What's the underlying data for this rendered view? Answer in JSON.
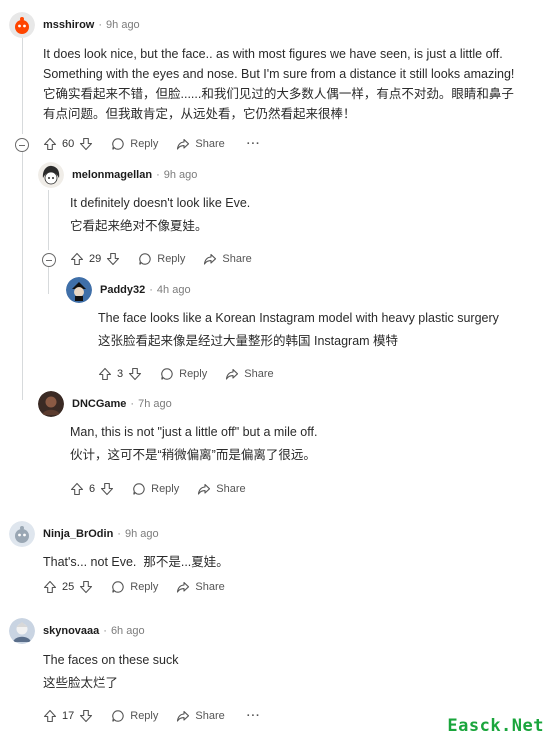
{
  "comments": [
    {
      "author": "msshirow",
      "sep": "·",
      "time": "9h ago",
      "text_en": "It does look nice, but the face.. as with most figures we have seen, is just a little off. Something with the eyes and nose. But I'm sure from a distance it still looks amazing!",
      "text_zh": "它确实看起来不错，但脸......和我们见过的大多数人偶一样，有点不对劲。眼睛和鼻子有点问题。但我敢肯定，从远处看，它仍然看起来很棒！",
      "votes": "60",
      "reply": "Reply",
      "share": "Share",
      "more": "···"
    },
    {
      "author": "melonmagellan",
      "sep": "·",
      "time": "9h ago",
      "text_en": "It definitely doesn't look like Eve.",
      "text_zh": "它看起来绝对不像夏娃。",
      "votes": "29",
      "reply": "Reply",
      "share": "Share"
    },
    {
      "author": "Paddy32",
      "sep": "·",
      "time": "4h ago",
      "text_en": "The face looks like a Korean Instagram model with heavy plastic surgery",
      "text_zh": "这张脸看起来像是经过大量整形的韩国 Instagram 模特",
      "votes": "3",
      "reply": "Reply",
      "share": "Share"
    },
    {
      "author": "DNCGame",
      "sep": "·",
      "time": "7h ago",
      "text_en": "Man, this is not \"just a little off\" but a mile off.",
      "text_zh": "伙计，这可不是“稍微偏离”而是偏离了很远。",
      "votes": "6",
      "reply": "Reply",
      "share": "Share"
    },
    {
      "author": "Ninja_BrOdin",
      "sep": "·",
      "time": "9h ago",
      "text_en": "That's... not Eve.",
      "text_zh": "那不是...夏娃。",
      "votes": "25",
      "reply": "Reply",
      "share": "Share"
    },
    {
      "author": "skynovaaa",
      "sep": "·",
      "time": "6h ago",
      "text_en": "The faces on these suck",
      "text_zh": "这些脸太烂了",
      "votes": "17",
      "reply": "Reply",
      "share": "Share",
      "more": "···"
    }
  ],
  "icons": {
    "upvote": "upvote-icon",
    "downvote": "downvote-icon",
    "reply": "reply-icon",
    "share": "share-icon",
    "collapse": "collapse-icon"
  },
  "watermark": "Easck.Net",
  "colors": {
    "background": "#ffffff",
    "thread_line": "#d7dadc",
    "meta": "#7c7c7c",
    "watermark": "#1aa53c"
  }
}
